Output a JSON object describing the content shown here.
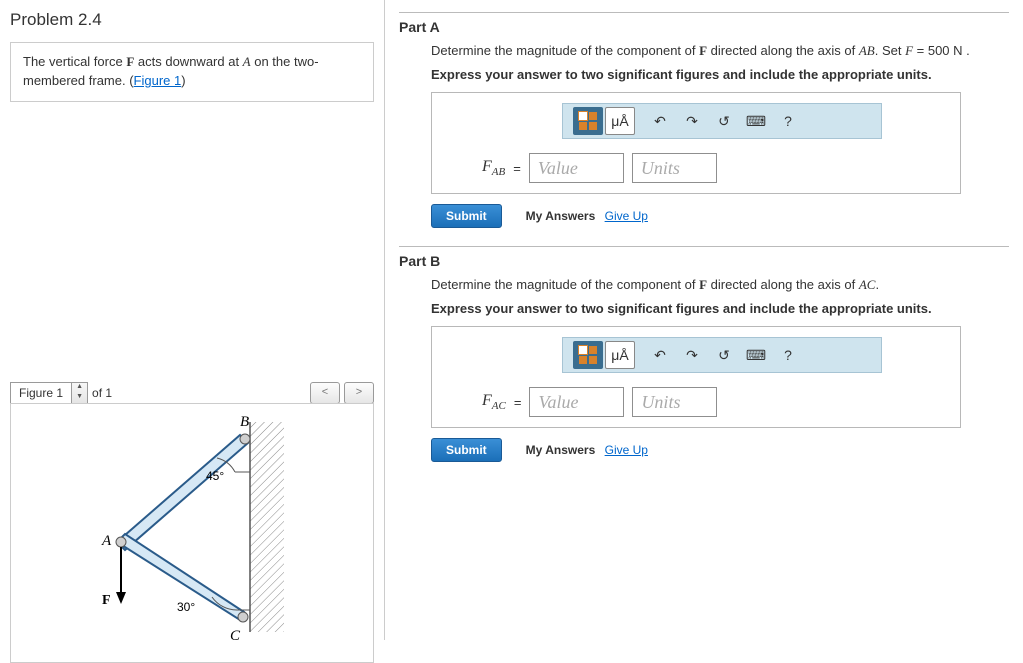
{
  "problem": {
    "title": "Problem 2.4",
    "prompt_pre": "The vertical force ",
    "prompt_F": "F",
    "prompt_mid": " acts downward at ",
    "prompt_A": "A",
    "prompt_post": " on the two-membered frame. (",
    "figure_link": "Figure 1",
    "prompt_close": ")"
  },
  "figure": {
    "label": "Figure 1",
    "of": "of 1",
    "prev": "<",
    "next": ">",
    "ptA": "A",
    "ptB": "B",
    "ptC": "C",
    "ptF": "F",
    "ang45": "45°",
    "ang30": "30°"
  },
  "toolbar": {
    "ua": "μÅ",
    "undo": "↶",
    "redo": "↷",
    "reset": "↺",
    "keys": "⌨",
    "help": "?"
  },
  "shared": {
    "instruction": "Express your answer to two significant figures and include the appropriate units.",
    "equals": "=",
    "value_ph": "Value",
    "units_ph": "Units",
    "submit": "Submit",
    "my_answers": "My Answers",
    "give_up": "Give Up"
  },
  "partA": {
    "title": "Part A",
    "q_pre": "Determine the magnitude of the component of ",
    "q_F": "F",
    "q_mid": " directed along the axis of ",
    "q_AB": "AB",
    "q_post": ". Set ",
    "q_Fi": "F",
    "q_val": " = 500 N .",
    "var": "F",
    "sub": "AB"
  },
  "partB": {
    "title": "Part B",
    "q_pre": "Determine the magnitude of the component of ",
    "q_F": "F",
    "q_mid": " directed along the axis of ",
    "q_AC": "AC",
    "q_post": ".",
    "var": "F",
    "sub": "AC"
  }
}
